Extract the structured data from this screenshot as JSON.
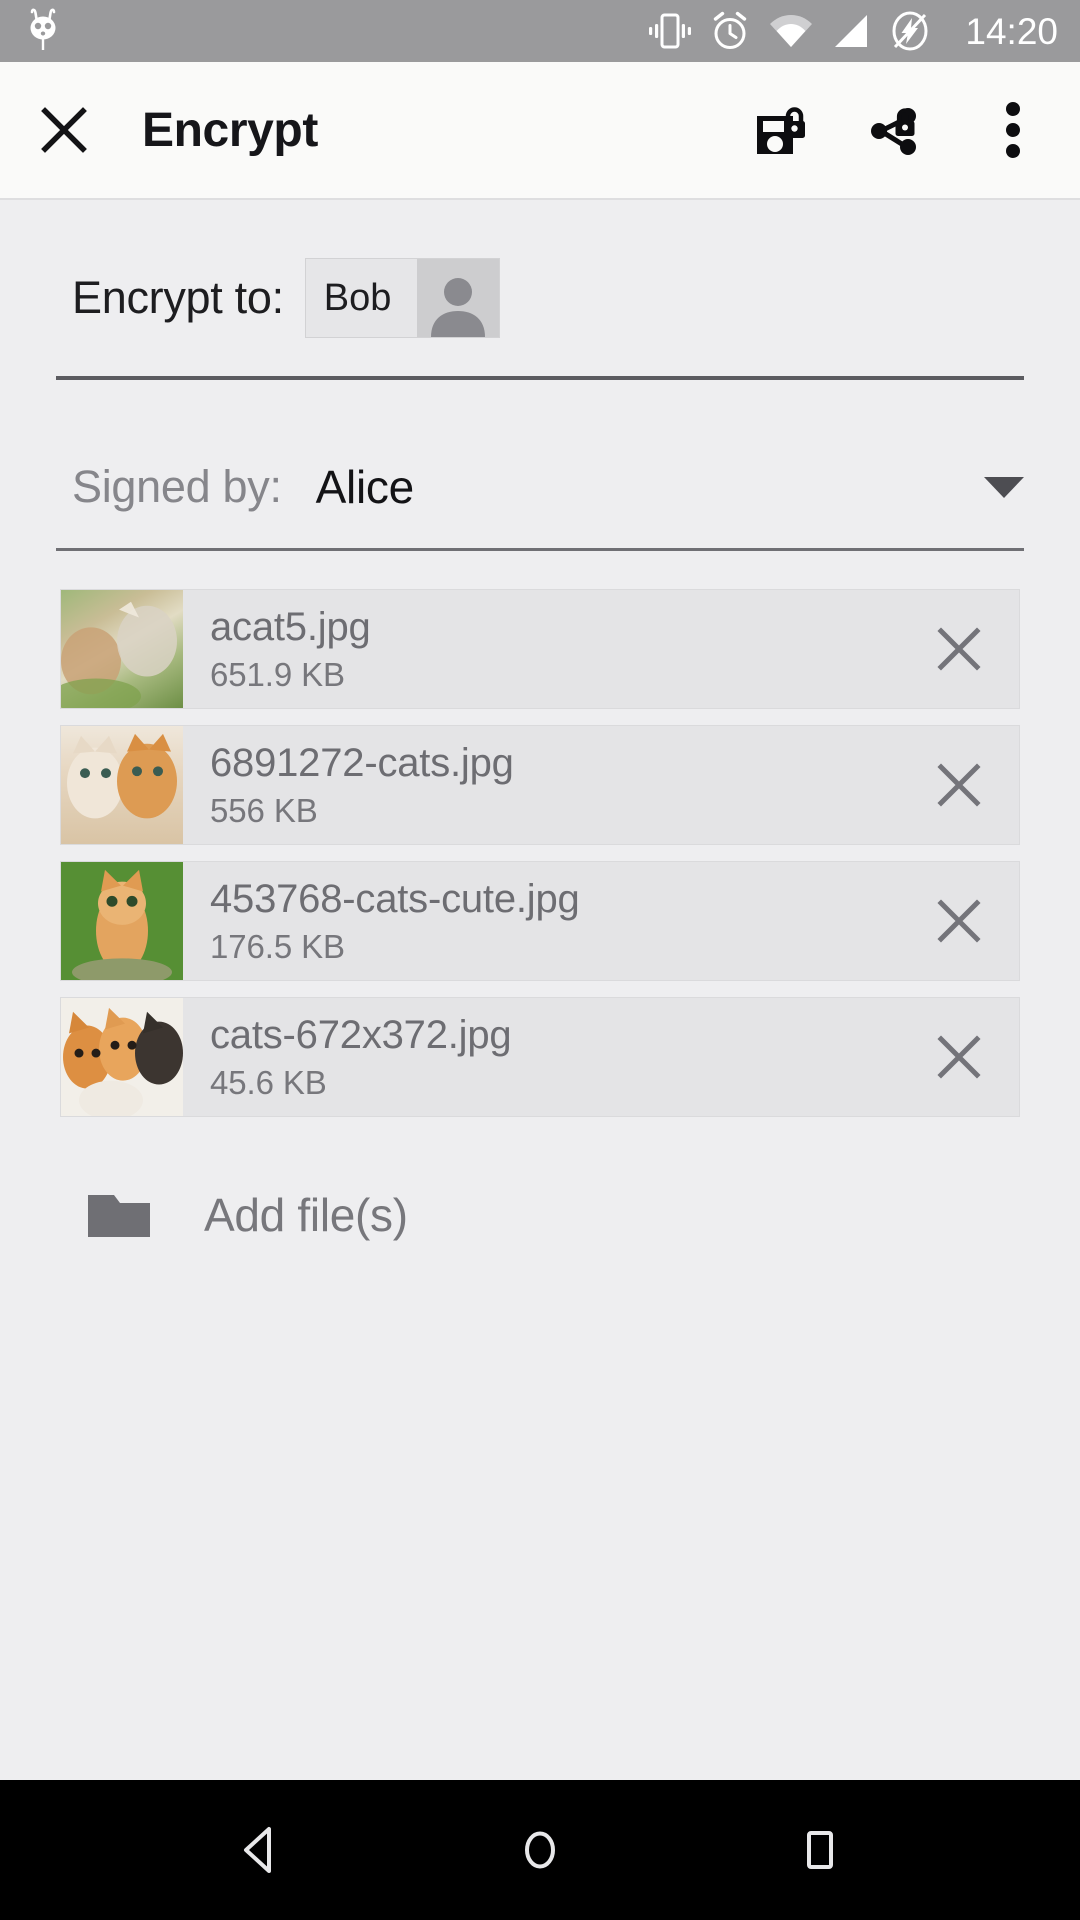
{
  "statusbar": {
    "time": "14:20",
    "icons": [
      {
        "name": "cyanogenmod-logo-icon"
      },
      {
        "name": "vibrate-icon"
      },
      {
        "name": "alarm-clock-icon"
      },
      {
        "name": "wifi-icon"
      },
      {
        "name": "cellular-signal-icon"
      },
      {
        "name": "charging-bolt-icon"
      }
    ]
  },
  "appbar": {
    "close_label": "close-icon",
    "title": "Encrypt",
    "actions": [
      {
        "name": "save-encrypted-icon",
        "label": "Save encrypted"
      },
      {
        "name": "share-encrypted-icon",
        "label": "Share encrypted"
      },
      {
        "name": "overflow-menu-icon",
        "label": "More options"
      }
    ]
  },
  "form": {
    "encrypt_to_label": "Encrypt to:",
    "recipient_chip": "Bob",
    "signed_by_label": "Signed by:",
    "signed_by_value": "Alice"
  },
  "files": [
    {
      "name": "acat5.jpg",
      "size": "651.9 KB",
      "remove_label": "×",
      "thumb": "cat-playful",
      "colors": [
        "#8fae6a",
        "#d9cfae",
        "#6b8a46"
      ]
    },
    {
      "name": "6891272-cats.jpg",
      "size": "556 KB",
      "remove_label": "×",
      "thumb": "two-kittens",
      "colors": [
        "#e8dfd3",
        "#d79a56",
        "#f0e8df"
      ]
    },
    {
      "name": "453768-cats-cute.jpg",
      "size": "176.5 KB",
      "remove_label": "×",
      "thumb": "kitten-grass",
      "colors": [
        "#5f8f3c",
        "#e0a463",
        "#83ae54"
      ]
    },
    {
      "name": "cats-672x372.jpg",
      "size": "45.6 KB",
      "remove_label": "×",
      "thumb": "kitten-group",
      "colors": [
        "#f2efe9",
        "#d98a3e",
        "#3a3430"
      ]
    }
  ],
  "add_files": {
    "label": "Add file(s)",
    "icon": "folder-icon"
  },
  "navbar": {
    "back": "back-triangle-icon",
    "home": "home-circle-icon",
    "recents": "recents-square-icon"
  },
  "colors": {
    "statusbar_bg": "#9a9a9c",
    "appbar_bg": "#fafaf9",
    "content_bg": "#eeeef0",
    "row_bg": "#e4e4e6",
    "text_primary": "#16161a",
    "text_secondary": "#6d6d72",
    "navbar_bg": "#000000"
  }
}
